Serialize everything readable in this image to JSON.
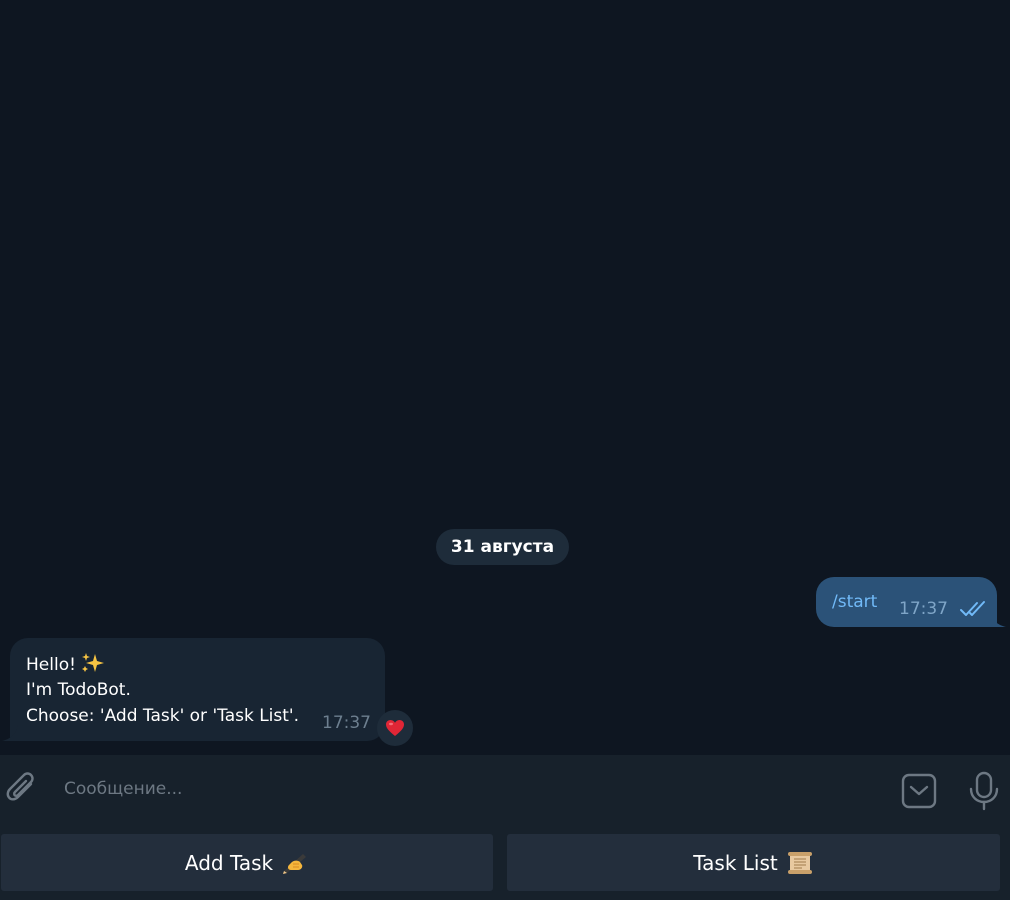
{
  "chat": {
    "date_label": "31 августа",
    "outgoing": {
      "text": "/start",
      "time": "17:37",
      "status_icon": "double-check-icon"
    },
    "incoming": {
      "line1": "Hello!",
      "line1_emoji": "sparkles-icon",
      "line2": "I'm TodoBot.",
      "line3": "Choose: 'Add Task' or 'Task List'.",
      "time": "17:37",
      "reaction": "heart-icon"
    }
  },
  "composer": {
    "placeholder": "Сообщение...",
    "value": ""
  },
  "reply_keyboard": {
    "buttons": [
      {
        "label": "Add Task",
        "emoji": "writing-hand-icon"
      },
      {
        "label": "Task List",
        "emoji": "scroll-icon"
      }
    ]
  },
  "colors": {
    "background": "#0e1621",
    "incoming_bubble": "#182533",
    "outgoing_bubble": "#2b5278",
    "panel": "#17212b",
    "button": "#232e3c",
    "accent": "#71baf8",
    "reaction_heart": "#e02636"
  }
}
